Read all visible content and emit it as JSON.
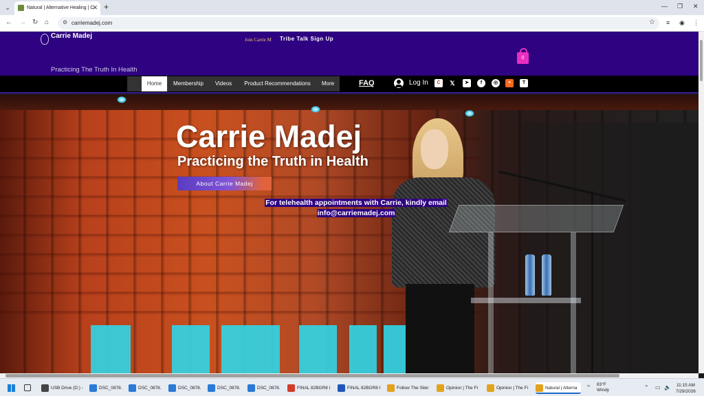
{
  "browser": {
    "tab_title": "Natural | Alternative Healing | C",
    "url": "carriemadej.com",
    "new_tab": "+",
    "close_tab": "✕"
  },
  "site": {
    "logo_name": "Carrie Madej",
    "join_text": "Join Carrie M",
    "tribe_signup": "Tribe Talk Sign Up",
    "cart_count": "0",
    "tagline": "Practicing The Truth In Health",
    "nav": [
      {
        "label": "Home",
        "active": true
      },
      {
        "label": "Membership"
      },
      {
        "label": "Videos"
      },
      {
        "label": "Product Recommendations"
      },
      {
        "label": "More"
      }
    ],
    "faq": "FAQ",
    "login": "Log In",
    "social_icons": [
      "c-icon",
      "x-icon",
      "telegram-icon",
      "facebook-icon",
      "instagram-icon",
      "substack-icon",
      "truth-social-icon"
    ]
  },
  "hero": {
    "title": "Carrie Madej",
    "subtitle": "Practicing the Truth in Health",
    "about_button": "About Carrie Madej",
    "telehealth_line1": "For telehealth appointments with Carrie, kindly email",
    "telehealth_line2": "info@carriemadej.com"
  },
  "taskbar": {
    "items": [
      {
        "label": "USB Drive (D:) -",
        "color": "#444"
      },
      {
        "label": "DSC_0878.",
        "color": "#2a7ad6"
      },
      {
        "label": "DSC_0878.",
        "color": "#2a7ad6"
      },
      {
        "label": "DSC_0878.",
        "color": "#2a7ad6"
      },
      {
        "label": "DSC_0878.",
        "color": "#2a7ad6"
      },
      {
        "label": "DSC_0878.",
        "color": "#2a7ad6"
      },
      {
        "label": "FINAL 82BGR8 I",
        "color": "#d23b2a"
      },
      {
        "label": "FINAL 82BGR8 I",
        "color": "#1f57b8"
      },
      {
        "label": "Follow The Siler",
        "color": "#e2a21c"
      },
      {
        "label": "Opinion | The Fi",
        "color": "#e2a21c"
      },
      {
        "label": "Opinion | The Fi",
        "color": "#e2a21c"
      },
      {
        "label": "Natural | Alterna",
        "color": "#e2a21c",
        "active": true
      }
    ],
    "weather_temp": "83°F",
    "weather_desc": "Windy",
    "time": "11:15 AM",
    "date": "7/29/2026"
  }
}
